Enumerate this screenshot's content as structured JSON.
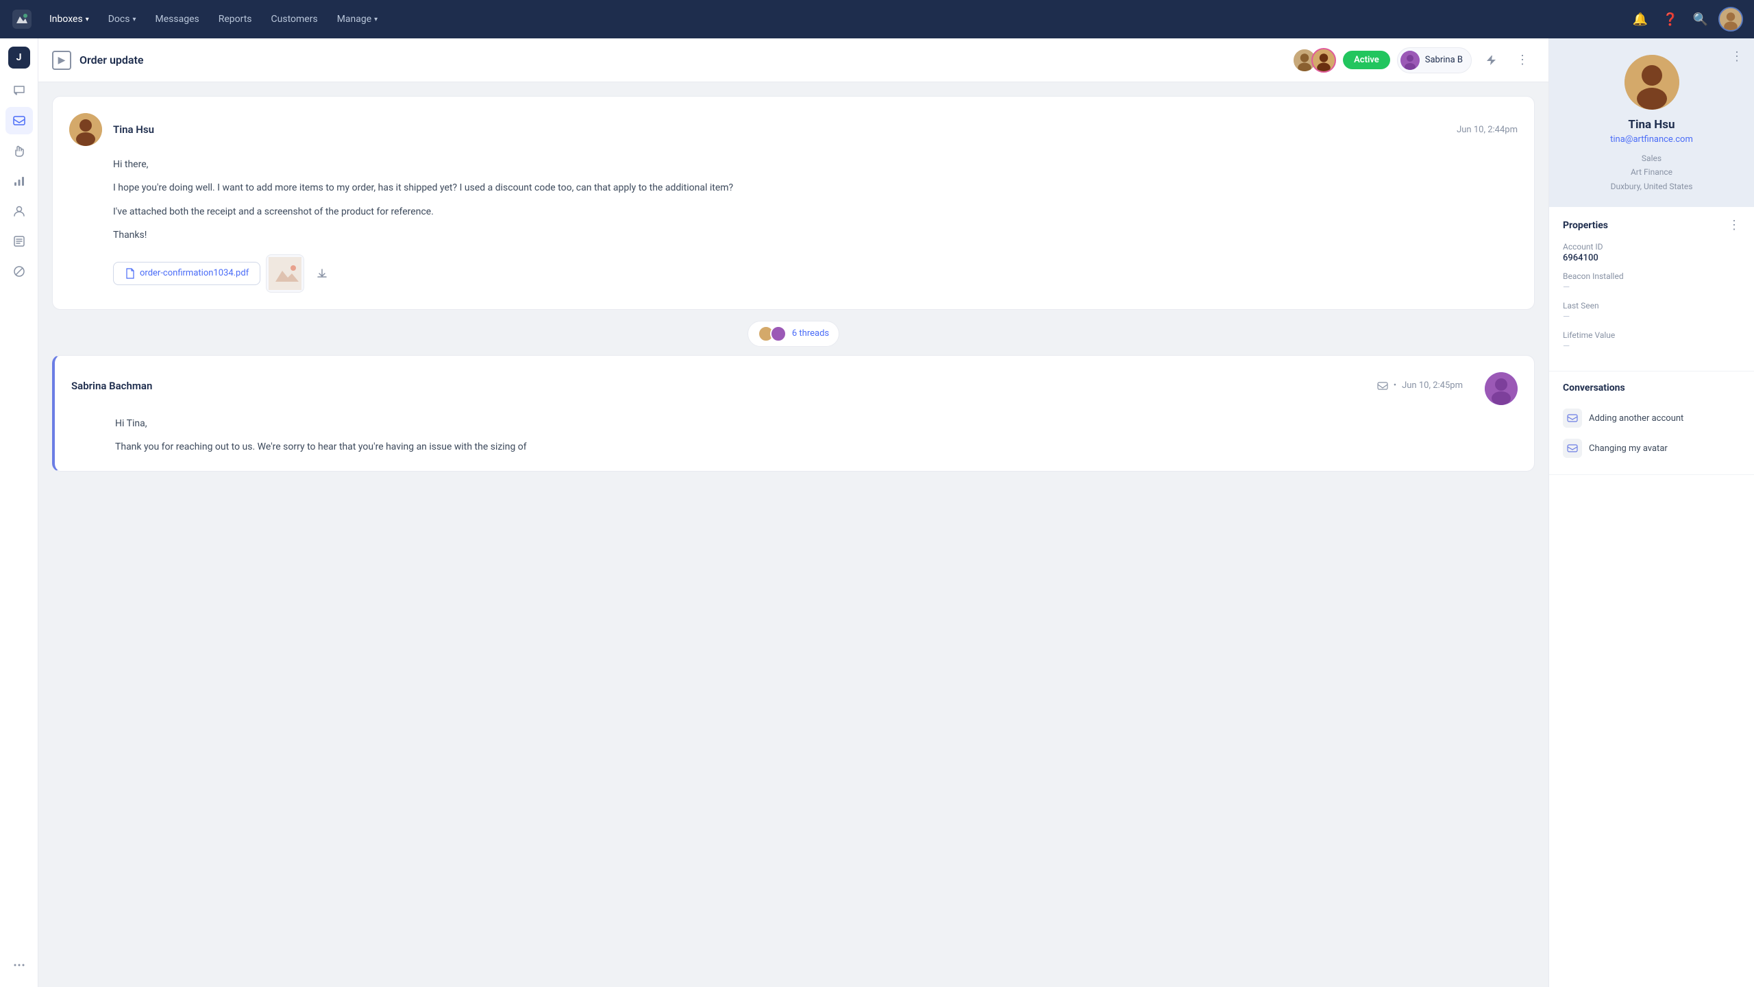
{
  "app": {
    "logo": "✏",
    "nav": [
      {
        "label": "Inboxes",
        "hasDropdown": true
      },
      {
        "label": "Docs",
        "hasDropdown": true
      },
      {
        "label": "Messages",
        "hasDropdown": false
      },
      {
        "label": "Reports",
        "hasDropdown": false
      },
      {
        "label": "Customers",
        "hasDropdown": false
      },
      {
        "label": "Manage",
        "hasDropdown": true
      }
    ]
  },
  "sidebar": {
    "initial": "J",
    "items": [
      {
        "icon": "💬",
        "name": "chat"
      },
      {
        "icon": "📧",
        "name": "inbox-active"
      },
      {
        "icon": "✋",
        "name": "hand"
      },
      {
        "icon": "📊",
        "name": "chart"
      },
      {
        "icon": "👤",
        "name": "user"
      },
      {
        "icon": "📋",
        "name": "list"
      },
      {
        "icon": "🚫",
        "name": "block"
      },
      {
        "icon": "•••",
        "name": "more"
      }
    ]
  },
  "conversation": {
    "title": "Order update",
    "status": "Active",
    "assigned_agent": "Sabrina B",
    "threads_label": "6 threads"
  },
  "customer": {
    "name": "Tina Hsu",
    "email": "tina@artfinance.com",
    "role": "Sales",
    "company": "Art Finance",
    "location": "Duxbury, United States"
  },
  "properties": {
    "title": "Properties",
    "account_id_label": "Account ID",
    "account_id_value": "6964100",
    "beacon_installed_label": "Beacon Installed",
    "beacon_installed_value": "—",
    "last_seen_label": "Last Seen",
    "last_seen_value": "—",
    "lifetime_value_label": "Lifetime Value",
    "lifetime_value_value": "—"
  },
  "conversations_panel": {
    "title": "Conversations",
    "items": [
      {
        "label": "Adding another account"
      },
      {
        "label": "Changing my avatar"
      }
    ]
  },
  "messages": [
    {
      "sender": "Tina Hsu",
      "time": "Jun 10, 2:44pm",
      "type": "customer",
      "paragraphs": [
        "Hi there,",
        "I hope you're doing well. I want to add more items to my order, has it shipped yet? I used a discount code too, can that apply to the additional item?",
        "I've attached both the receipt and a screenshot of the product for reference.",
        "Thanks!"
      ],
      "attachment_pdf": "order-confirmation1034.pdf",
      "has_img_attachment": true,
      "has_download": true
    },
    {
      "sender": "Sabrina Bachman",
      "time": "Jun 10, 2:45pm",
      "type": "agent",
      "paragraphs": [
        "Hi Tina,",
        "Thank you for reaching out to us. We're sorry to hear that you're having an issue with the sizing of"
      ]
    }
  ]
}
